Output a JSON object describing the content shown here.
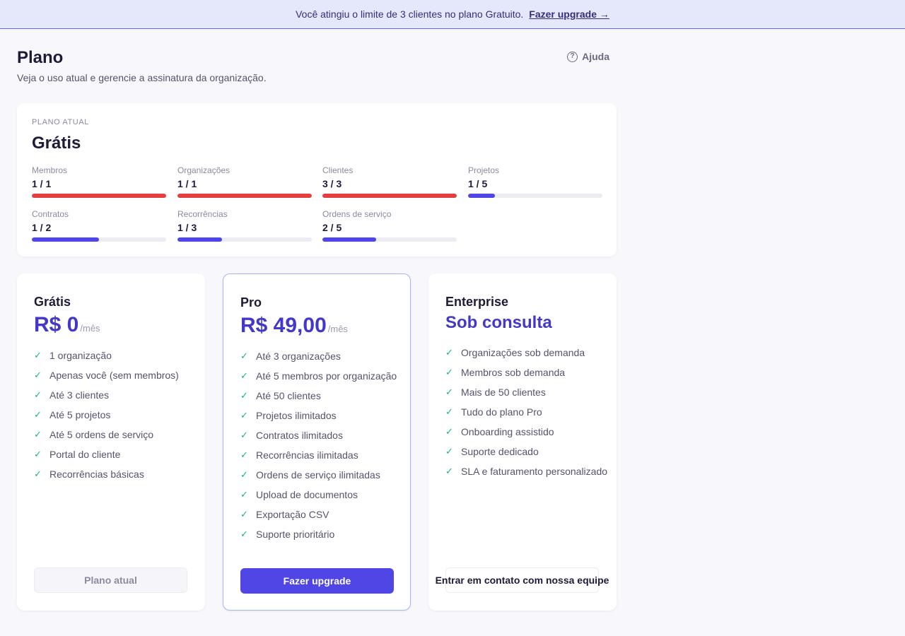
{
  "banner": {
    "message": "Você atingiu o limite de 3 clientes no plano Gratuito.",
    "link": "Fazer upgrade →"
  },
  "header": {
    "title": "Plano",
    "subtitle": "Veja o uso atual e gerencie a assinatura da organização.",
    "help": "Ajuda"
  },
  "current_plan": {
    "label": "PLANO ATUAL",
    "name": "Grátis",
    "usage": [
      {
        "label": "Membros",
        "value": "1 / 1",
        "fraction": 1.0
      },
      {
        "label": "Organizações",
        "value": "1 / 1",
        "fraction": 1.0
      },
      {
        "label": "Clientes",
        "value": "3 / 3",
        "fraction": 1.0
      },
      {
        "label": "Projetos",
        "value": "1 / 5",
        "fraction": 0.2
      },
      {
        "label": "Contratos",
        "value": "1 / 2",
        "fraction": 0.5
      },
      {
        "label": "Recorrências",
        "value": "1 / 3",
        "fraction": 0.333
      },
      {
        "label": "Ordens de serviço",
        "value": "2 / 5",
        "fraction": 0.4
      }
    ]
  },
  "plans": [
    {
      "name": "Grátis",
      "price": "R$ 0",
      "period": "/mês",
      "features": [
        "1 organização",
        "Apenas você (sem membros)",
        "Até 3 clientes",
        "Até 5 projetos",
        "Até 5 ordens de serviço",
        "Portal do cliente",
        "Recorrências básicas"
      ],
      "button": "Plano atual"
    },
    {
      "name": "Pro",
      "price": "R$ 49,00",
      "period": "/mês",
      "features": [
        "Até 3 organizações",
        "Até 5 membros por organização",
        "Até 50 clientes",
        "Projetos ilimitados",
        "Contratos ilimitados",
        "Recorrências ilimitadas",
        "Ordens de serviço ilimitadas",
        "Upload de documentos",
        "Exportação CSV",
        "Suporte prioritário"
      ],
      "button": "Fazer upgrade"
    },
    {
      "name": "Enterprise",
      "price": "Sob consulta",
      "period": "",
      "features": [
        "Organizações sob demanda",
        "Membros sob demanda",
        "Mais de 50 clientes",
        "Tudo do plano Pro",
        "Onboarding assistido",
        "Suporte dedicado",
        "SLA e faturamento personalizado"
      ],
      "button": "Entrar em contato com nossa equipe"
    }
  ],
  "colors": {
    "accent": "#4f46e5",
    "limit_reached": "#e53e3e",
    "check": "#10b981"
  }
}
